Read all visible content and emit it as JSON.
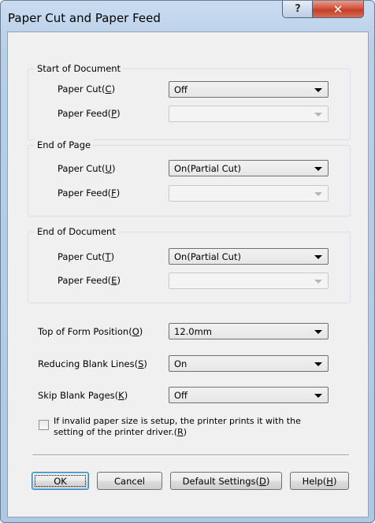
{
  "window": {
    "title": "Paper Cut and Paper Feed",
    "help_glyph": "?",
    "close_glyph": "✕"
  },
  "start_of_document": {
    "title": "Start of Document",
    "paper_cut": {
      "label": "Paper Cut(",
      "mnemonic": "C",
      "suffix": ")",
      "value": "Off"
    },
    "paper_feed": {
      "label": "Paper Feed(",
      "mnemonic": "P",
      "suffix": ")",
      "value": "",
      "disabled": true
    }
  },
  "end_of_page": {
    "title": "End of Page",
    "paper_cut": {
      "label": "Paper Cut(",
      "mnemonic": "U",
      "suffix": ")",
      "value": "On(Partial Cut)"
    },
    "paper_feed": {
      "label": "Paper Feed(",
      "mnemonic": "F",
      "suffix": ")",
      "value": "",
      "disabled": true
    }
  },
  "end_of_document": {
    "title": "End of Document",
    "paper_cut": {
      "label": "Paper Cut(",
      "mnemonic": "T",
      "suffix": ")",
      "value": "On(Partial Cut)"
    },
    "paper_feed": {
      "label": "Paper Feed(",
      "mnemonic": "E",
      "suffix": ")",
      "value": "",
      "disabled": true
    }
  },
  "top_of_form": {
    "label": "Top of Form Position(",
    "mnemonic": "O",
    "suffix": ")",
    "value": "12.0mm"
  },
  "reducing_blank_lines": {
    "label": "Reducing Blank Lines(",
    "mnemonic": "S",
    "suffix": ")",
    "value": "On"
  },
  "skip_blank_pages": {
    "label": "Skip Blank Pages(",
    "mnemonic": "K",
    "suffix": ")",
    "value": "Off"
  },
  "invalid_paper_check": {
    "line1": "If invalid paper size is setup, the printer prints it with the",
    "line2": "setting of the printer driver.(",
    "mnemonic": "R",
    "suffix": ")",
    "checked": false
  },
  "buttons": {
    "ok": "OK",
    "cancel": "Cancel",
    "default_label": "Default Settings(",
    "default_mnemonic": "D",
    "default_suffix": ")",
    "help_label": "Help(",
    "help_mnemonic": "H",
    "help_suffix": ")"
  },
  "colors": {
    "frame": "#b8cfe8",
    "client": "#f0f0f0",
    "close_button": "#c33f2a",
    "default_button_border": "#3c7fb1"
  }
}
